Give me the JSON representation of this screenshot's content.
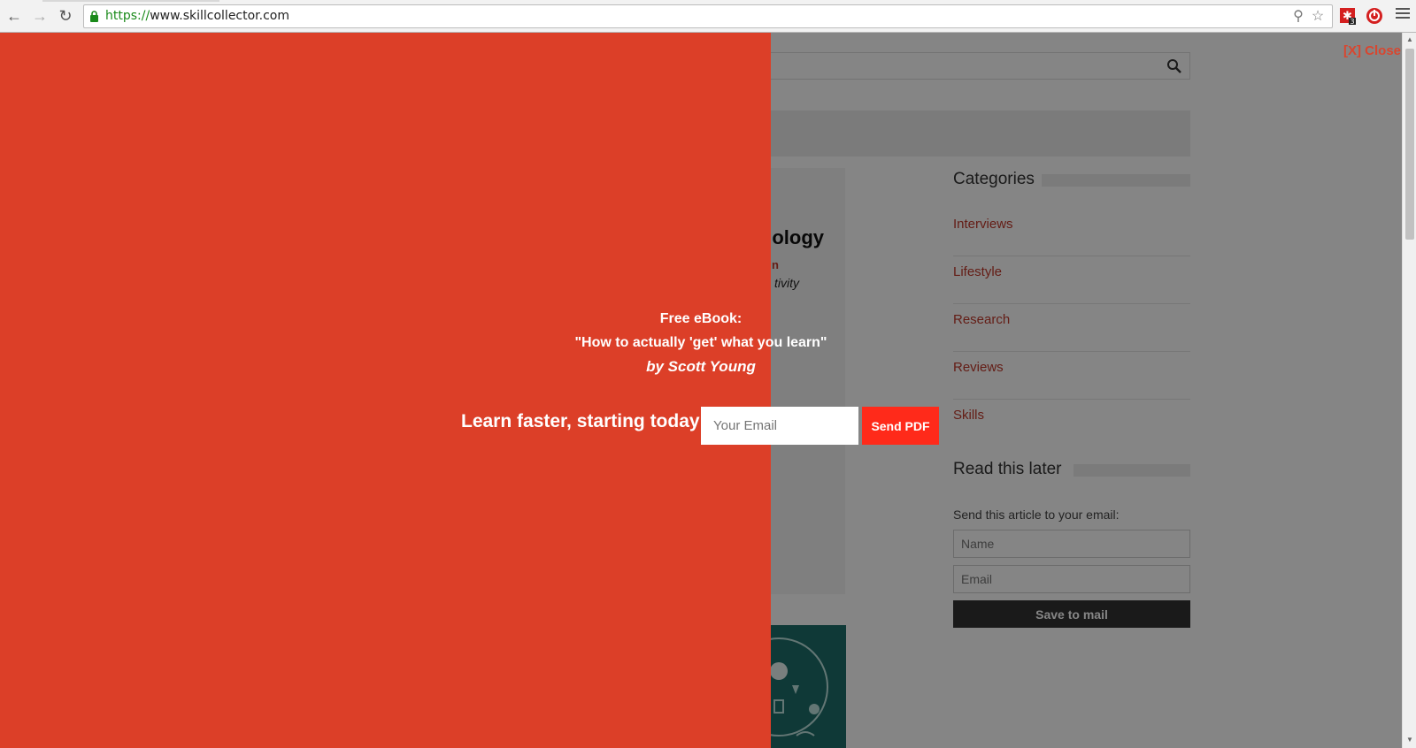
{
  "browser": {
    "url_scheme": "https://",
    "url_rest": "www.skillcollector.com",
    "extension_badge": "3"
  },
  "page": {
    "article": {
      "title_fragment": "ology",
      "subtitle_fragment": "n",
      "italic_fragment": "tivity"
    },
    "sidebar": {
      "categories_heading": "Categories",
      "categories": [
        "Interviews",
        "Lifestyle",
        "Research",
        "Reviews",
        "Skills"
      ],
      "read_later_heading": "Read this later",
      "read_later_desc": "Send this article to your email:",
      "name_placeholder": "Name",
      "email_placeholder": "Email",
      "save_button": "Save to mail"
    }
  },
  "optin": {
    "close_label": "[X] Close",
    "ebook_line1": "Free eBook:",
    "ebook_line2": "\"How to actually 'get' what you learn\"",
    "ebook_author": "by Scott Young",
    "tagline": "Learn faster, starting today",
    "email_placeholder": "Your Email",
    "send_button": "Send PDF"
  },
  "colors": {
    "panel_red": "#dc3f28",
    "button_red": "#ff2a1a",
    "link_red": "#c0392b"
  }
}
